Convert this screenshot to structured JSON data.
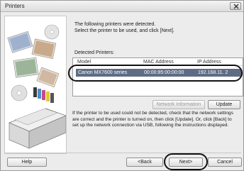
{
  "window": {
    "title": "Printers"
  },
  "intro": {
    "line1": "The following printers were detected.",
    "line2": "Select the printer to be used, and click [Next]."
  },
  "detected": {
    "label": "Detected Printers:",
    "columns": [
      "Model",
      "MAC Address",
      "IP Address"
    ],
    "rows": [
      {
        "model": "Canon MX7600 series",
        "mac": "00:00:85:00:00:00",
        "ip": "192.168.11. 2"
      }
    ]
  },
  "buttons": {
    "network_info": "Network Information",
    "update": "Update",
    "help": "Help",
    "back": "<Back",
    "next": "Next>",
    "cancel": "Cancel"
  },
  "help_text": {
    "line1": "If the printer to be used could not be detected, check that the network settings",
    "line2": "are correct and the printer is turned on, then click [Update]. Or, click [Back] to",
    "line3": "set up the network connection via USB, following the instructions displayed."
  },
  "colors": {
    "selected_row": "#5f6c85",
    "dialog_bg": "#ececec"
  }
}
